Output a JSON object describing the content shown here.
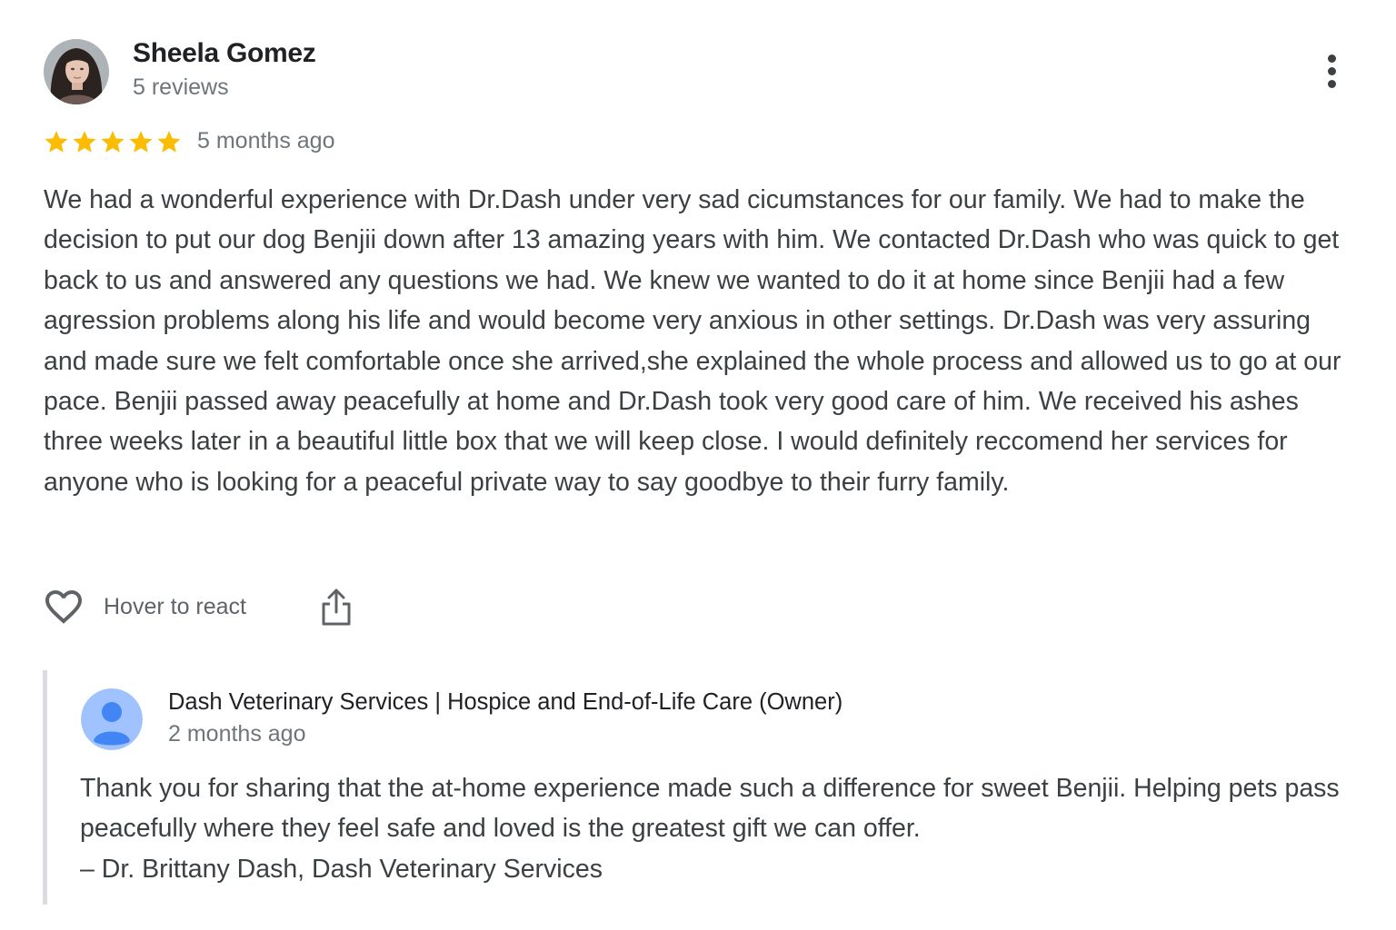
{
  "reviewer": {
    "name": "Sheela Gomez",
    "meta": "5 reviews",
    "avatar_icon": "profile-photo"
  },
  "review": {
    "rating": 5,
    "rating_max": 5,
    "star_color": "#fbbc04",
    "date": "5 months ago",
    "text": "We had a wonderful experience with Dr.Dash under very sad cicumstances for our family. We had to make the decision to put our dog Benjii down after 13 amazing years with him. We contacted Dr.Dash who was quick to get back to us and answered any questions we had. We knew we wanted to do it at home since Benjii had a few agression problems along his life and would become very anxious in other settings. Dr.Dash was very assuring and made sure we felt comfortable once she arrived,she explained the whole process and allowed us to go at our pace. Benjii passed away peacefully at home and Dr.Dash took very good care of him. We received his ashes three weeks later in a beautiful little box that we will keep close. I would definitely reccomend her services for anyone who is looking for a peaceful private way to say goodbye to their furry family."
  },
  "actions": {
    "react_label": "Hover to react",
    "react_icon": "heart-icon",
    "share_icon": "share-icon",
    "more_icon": "more-vert-icon"
  },
  "reply": {
    "owner_name": "Dash Veterinary Services | Hospice and End-of-Life Care (Owner)",
    "date": "2 months ago",
    "avatar_icon": "person-icon",
    "avatar_color": "#a0c3ff",
    "text_line1": "Thank you for sharing that the at-home experience made such a difference for sweet Benjii. Helping pets pass peacefully where they feel safe and loved is the greatest gift we can offer.",
    "text_line2": "– Dr. Brittany Dash, Dash Veterinary Services"
  }
}
